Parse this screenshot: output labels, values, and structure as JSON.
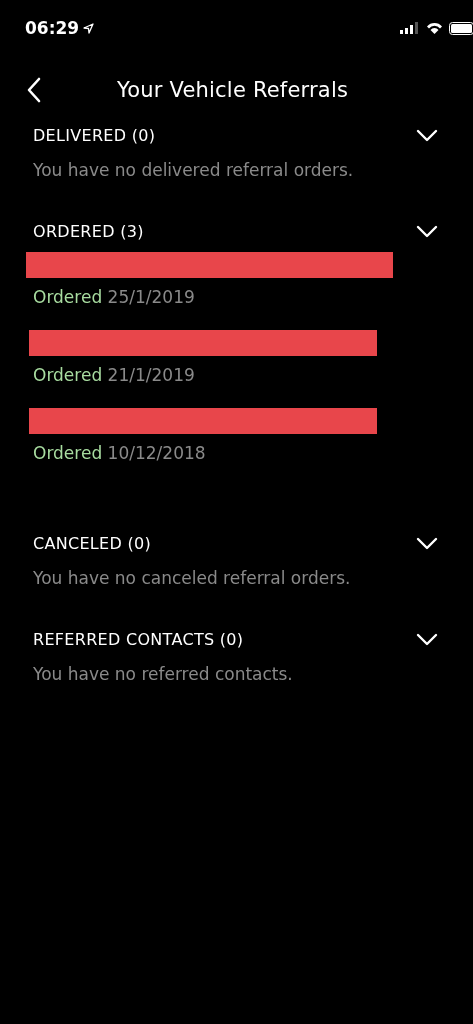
{
  "status_bar": {
    "time": "06:29"
  },
  "header": {
    "title": "Your Vehicle Referrals"
  },
  "sections": [
    {
      "title": "DELIVERED (0)",
      "empty_message": "You have no delivered referral orders."
    },
    {
      "title": "ORDERED (3)",
      "orders": [
        {
          "status": "Ordered",
          "date": "25/1/2019"
        },
        {
          "status": "Ordered",
          "date": "21/1/2019"
        },
        {
          "status": "Ordered",
          "date": "10/12/2018"
        }
      ]
    },
    {
      "title": "CANCELED (0)",
      "empty_message": "You have no canceled referral orders."
    },
    {
      "title": "REFERRED CONTACTS (0)",
      "empty_message": "You have no referred contacts."
    }
  ]
}
